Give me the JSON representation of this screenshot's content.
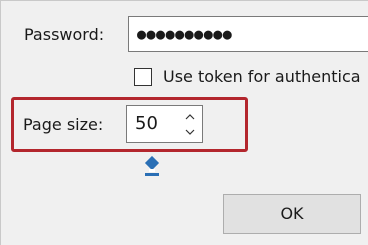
{
  "password": {
    "label": "Password:",
    "masked_value": "●●●●●●●●●●"
  },
  "token_checkbox": {
    "label": "Use token for authentica",
    "checked": false
  },
  "page_size": {
    "label": "Page size:",
    "value": "50"
  },
  "icons": {
    "spin_up": "chevron-up-icon",
    "spin_down": "chevron-down-icon",
    "eraser": "eraser-icon"
  },
  "ok_button": {
    "label": "OK"
  },
  "colors": {
    "highlight": "#b3262d",
    "eraser_blue": "#2a6fb5",
    "dialog_bg": "#f0f0f0"
  }
}
